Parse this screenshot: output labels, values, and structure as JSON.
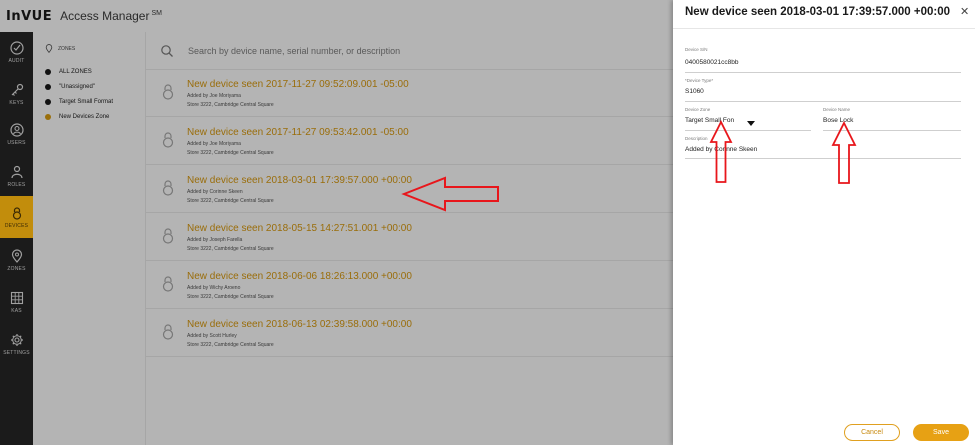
{
  "app": {
    "logo": "InVUE",
    "name": "Access Manager",
    "mark": "SM"
  },
  "nav": [
    {
      "label": "AUDIT",
      "icon": "audit-icon"
    },
    {
      "label": "KEYS",
      "icon": "key-icon"
    },
    {
      "label": "USERS",
      "icon": "users-icon"
    },
    {
      "label": "ROLES",
      "icon": "roles-icon"
    },
    {
      "label": "DEVICES",
      "icon": "lock-icon",
      "active": true
    },
    {
      "label": "ZONES",
      "icon": "location-pin-icon"
    },
    {
      "label": "KAS",
      "icon": "grid-icon"
    },
    {
      "label": "SETTINGS",
      "icon": "gear-icon"
    }
  ],
  "zones": {
    "header": "ZONES",
    "items": [
      "ALL ZONES",
      "\"Unassigned\"",
      "Target Small Format",
      "New Devices Zone"
    ]
  },
  "search": {
    "placeholder": "Search by device name, serial number, or description"
  },
  "devices": [
    {
      "title": "New device seen 2017-11-27 09:52:09.001 -05:00",
      "added_by": "Added by Joe Moriyama",
      "store": "Store 3222, Cambridge Central Square"
    },
    {
      "title": "New device seen 2017-11-27 09:53:42.001 -05:00",
      "added_by": "Added by Joe Moriyama",
      "store": "Store 3222, Cambridge Central Square"
    },
    {
      "title": "New device seen 2018-03-01 17:39:57.000 +00:00",
      "added_by": "Added by Corinne Skeen",
      "store": "Store 3222, Cambridge Central Square"
    },
    {
      "title": "New device seen 2018-05-15 14:27:51.001 +00:00",
      "added_by": "Added by Joseph Farella",
      "store": "Store 3222, Cambridge Central Square"
    },
    {
      "title": "New device seen 2018-06-06 18:26:13.000 +00:00",
      "added_by": "Added by Wichy Aroeno",
      "store": "Store 3222, Cambridge Central Square"
    },
    {
      "title": "New device seen 2018-06-13 02:39:58.000 +00:00",
      "added_by": "Added by Scott Hurley",
      "store": "Store 3222, Cambridge Central Square"
    }
  ],
  "drawer": {
    "title": "New device seen 2018-03-01 17:39:57.000 +00:00",
    "close": "✕",
    "serial_label": "Device S/N",
    "serial_value": "0400580021cc8bb",
    "type_label": "*Device Type*",
    "type_value": "S1060",
    "zone_label": "Device Zone",
    "zone_value": "Target Small Fon",
    "name_label": "Device Name",
    "name_value": "Bose Lock",
    "desc_label": "Description",
    "desc_value": "Added by Corinne Skeen",
    "cancel": "Cancel",
    "save": "Save"
  },
  "colors": {
    "accent": "#e7a114",
    "title_link": "#9a6d0a",
    "rail": "#1b1b1b",
    "annotation": "#e8161b"
  }
}
